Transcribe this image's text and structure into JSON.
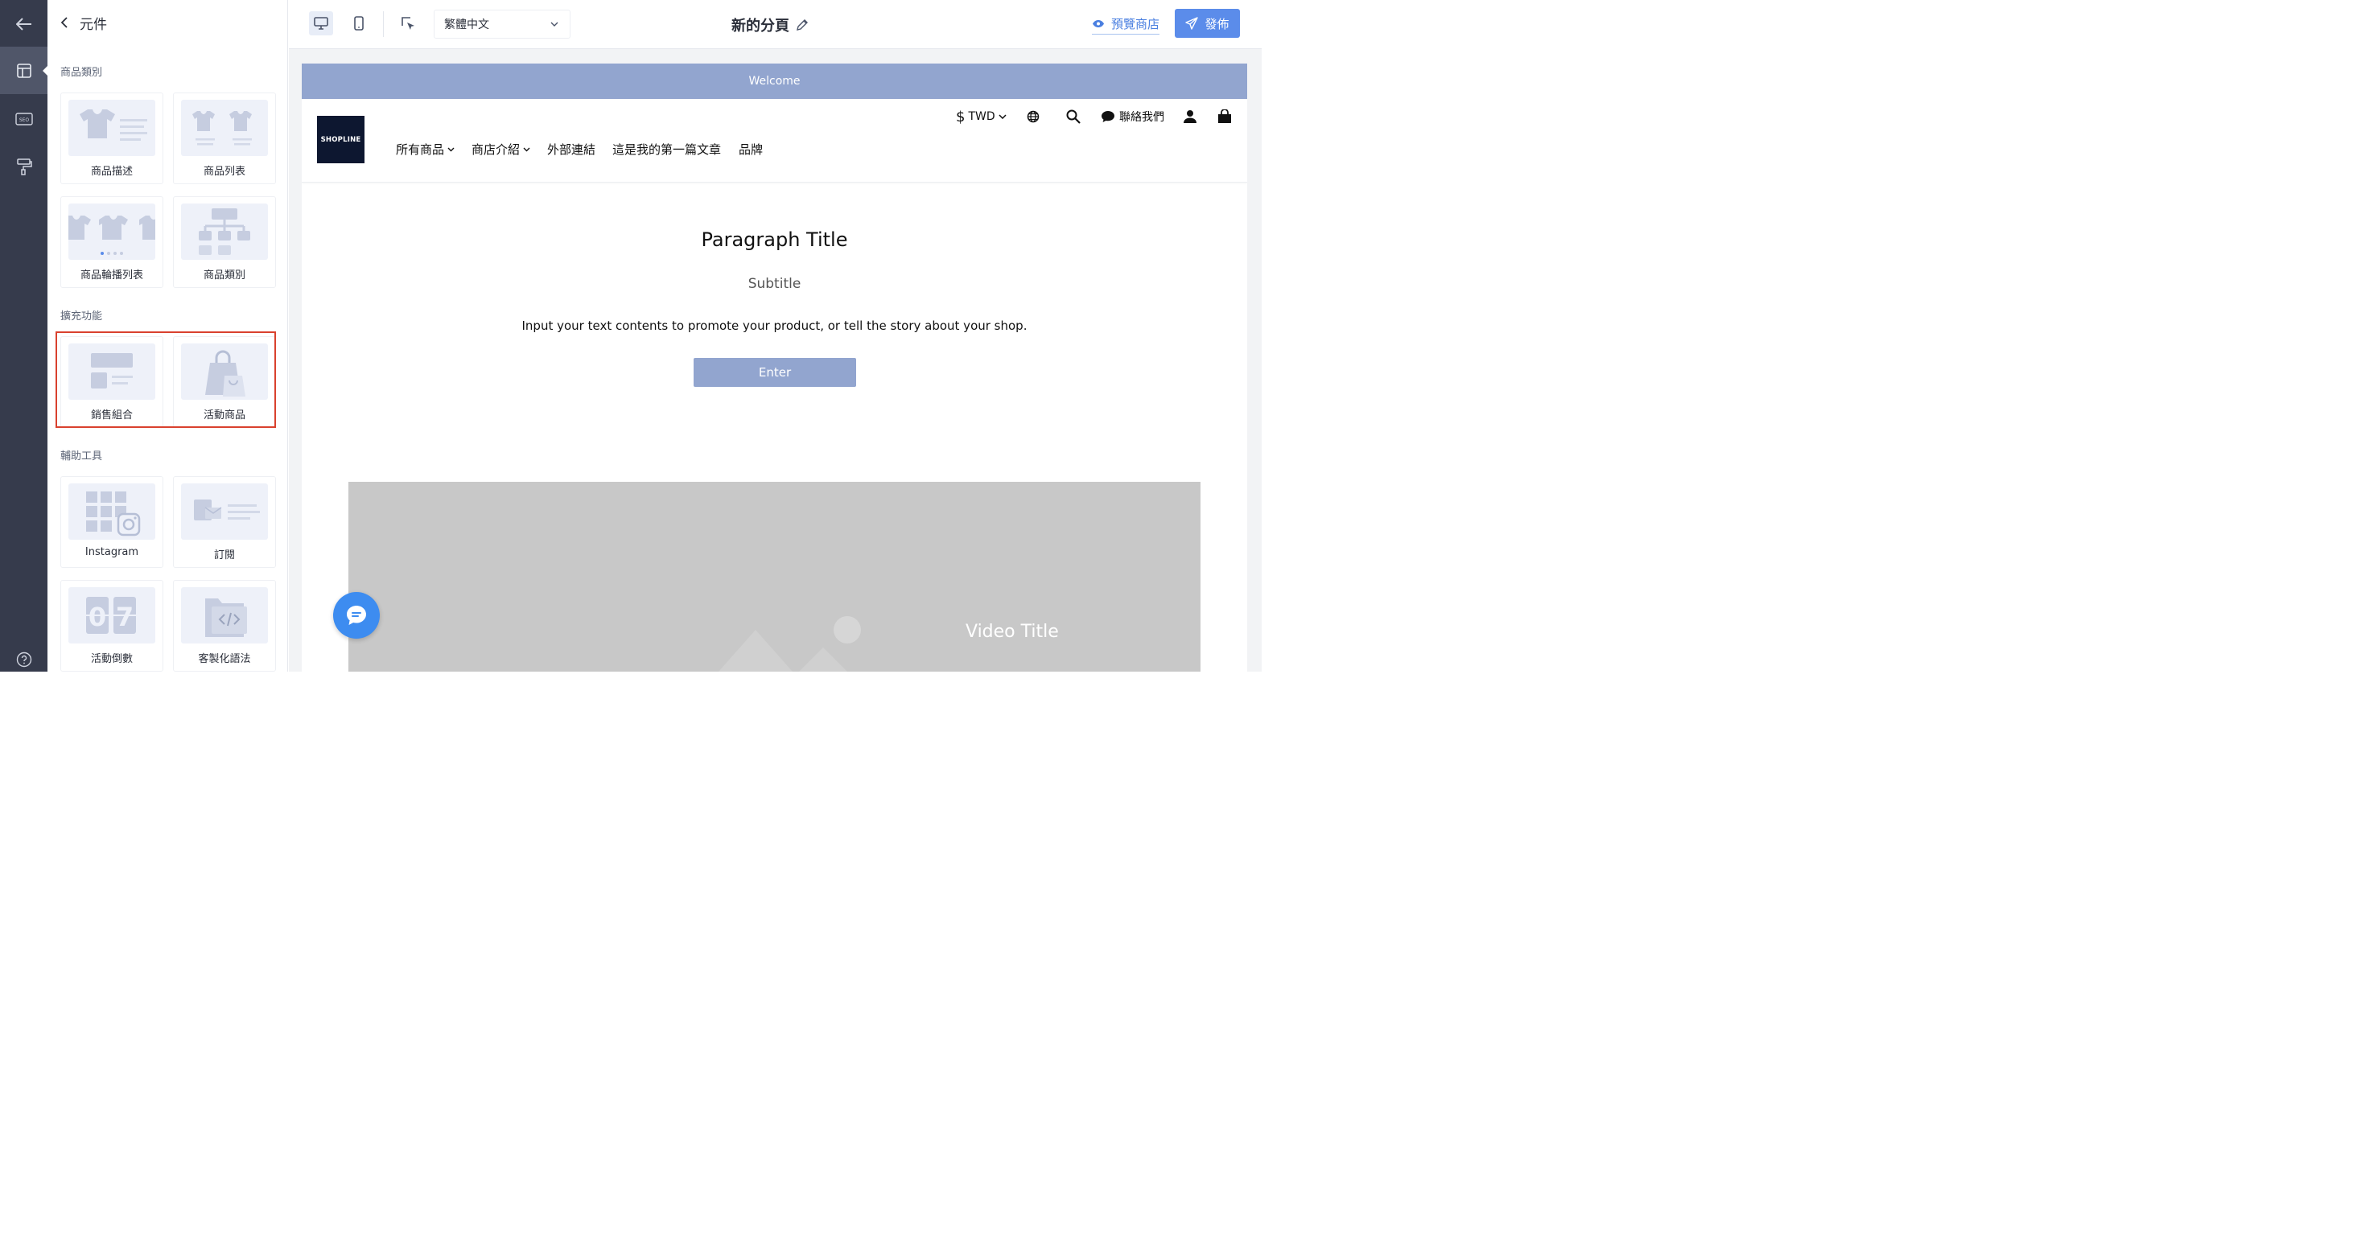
{
  "panel": {
    "back_label": "元件",
    "sections": [
      {
        "label": "商品類別",
        "cards": [
          {
            "label": "商品描述",
            "icon": "product-description-icon"
          },
          {
            "label": "商品列表",
            "icon": "product-list-icon"
          },
          {
            "label": "商品輪播列表",
            "icon": "product-carousel-icon"
          },
          {
            "label": "商品類別",
            "icon": "product-category-icon"
          }
        ]
      },
      {
        "label": "擴充功能",
        "cards": [
          {
            "label": "銷售組合",
            "icon": "sales-bundle-icon"
          },
          {
            "label": "活動商品",
            "icon": "promotion-products-icon"
          }
        ]
      },
      {
        "label": "輔助工具",
        "cards": [
          {
            "label": "Instagram",
            "icon": "instagram-icon"
          },
          {
            "label": "訂閱",
            "icon": "subscribe-icon"
          },
          {
            "label": "活動倒數",
            "icon": "countdown-icon"
          },
          {
            "label": "客製化語法",
            "icon": "custom-code-icon"
          }
        ]
      }
    ]
  },
  "topbar": {
    "language": "繁體中文",
    "page_title": "新的分頁",
    "preview_label": "預覽商店",
    "publish_label": "發佈"
  },
  "store": {
    "welcome": "Welcome",
    "logo_text": "SHOPLINE",
    "currency": "TWD",
    "currency_symbol": "$",
    "contact_label": "聯絡我們",
    "nav": [
      {
        "label": "所有商品",
        "dropdown": true
      },
      {
        "label": "商店介紹",
        "dropdown": true
      },
      {
        "label": "外部連結",
        "dropdown": false
      },
      {
        "label": "這是我的第一篇文章",
        "dropdown": false
      },
      {
        "label": "品牌",
        "dropdown": false
      }
    ],
    "paragraph": {
      "title": "Paragraph Title",
      "subtitle": "Subtitle",
      "body": "Input your text contents to promote your product, or tell the story about your shop.",
      "button": "Enter"
    },
    "video_title": "Video Title"
  },
  "colors": {
    "rail": "#363b4c",
    "accent": "#5b8cea",
    "welcome_bar": "#92a5cf",
    "highlight": "#d9412e"
  }
}
